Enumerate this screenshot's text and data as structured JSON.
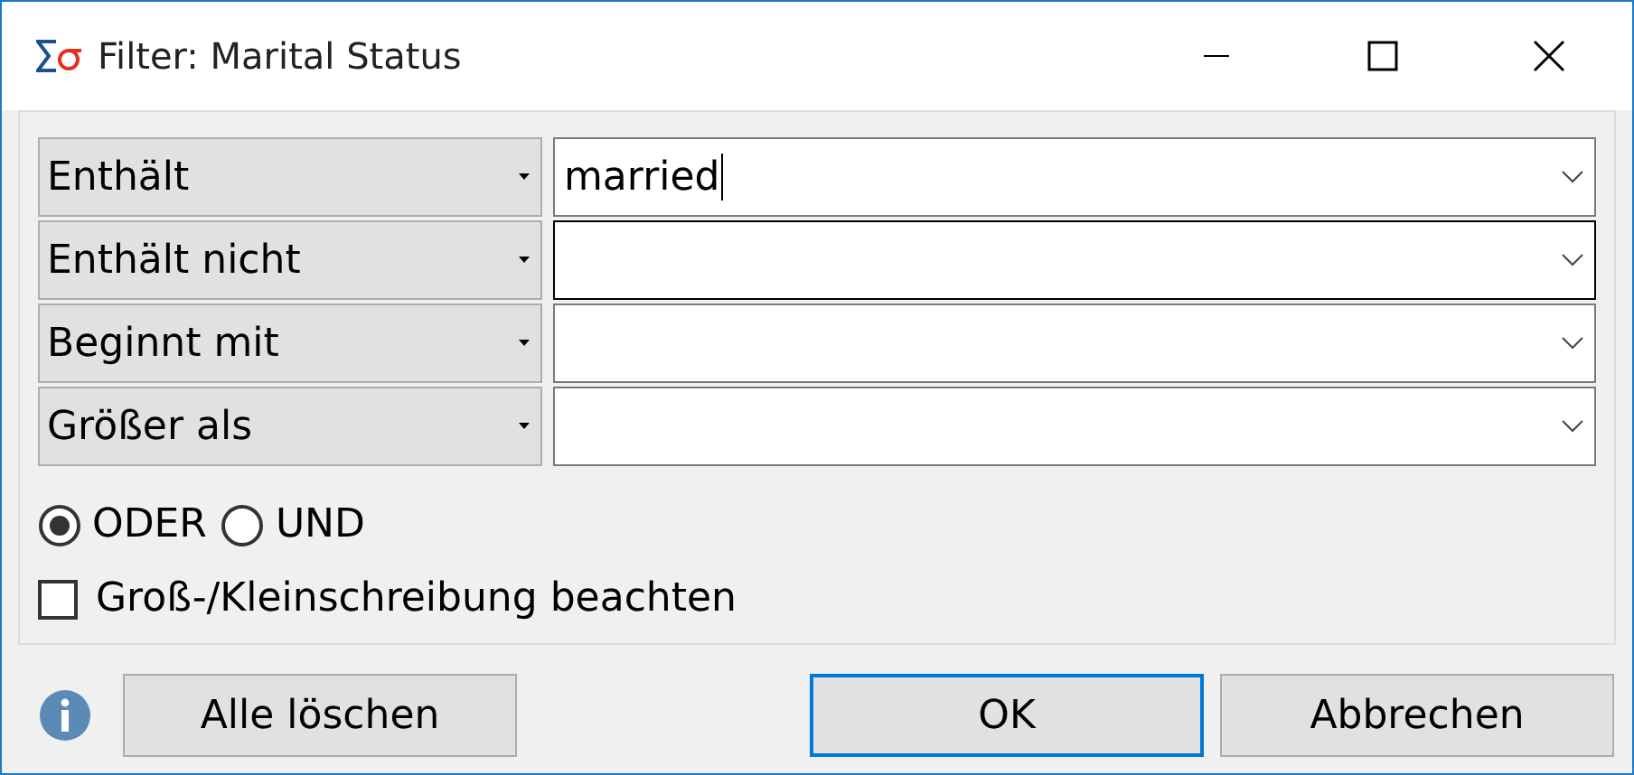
{
  "window": {
    "title": "Filter: Marital Status"
  },
  "conditions": [
    {
      "operator": "Enthält",
      "value": "married",
      "focused": true,
      "hovered": false
    },
    {
      "operator": "Enthält nicht",
      "focused": false,
      "hovered": true
    },
    {
      "operator": "Beginnt mit",
      "focused": false,
      "hovered": false
    },
    {
      "operator": "Größer als",
      "focused": false,
      "hovered": false
    }
  ],
  "logic": [
    {
      "label": "ODER",
      "selected": true
    },
    {
      "label": "UND",
      "selected": false
    }
  ],
  "case_sensitive": {
    "label": "Groß-/Kleinschreibung beachten",
    "checked": false
  },
  "buttons": [
    {
      "label": "Alle löschen",
      "kind": "secondary"
    },
    {
      "label": "OK",
      "kind": "default"
    },
    {
      "label": "Abbrechen",
      "kind": "normal"
    }
  ]
}
